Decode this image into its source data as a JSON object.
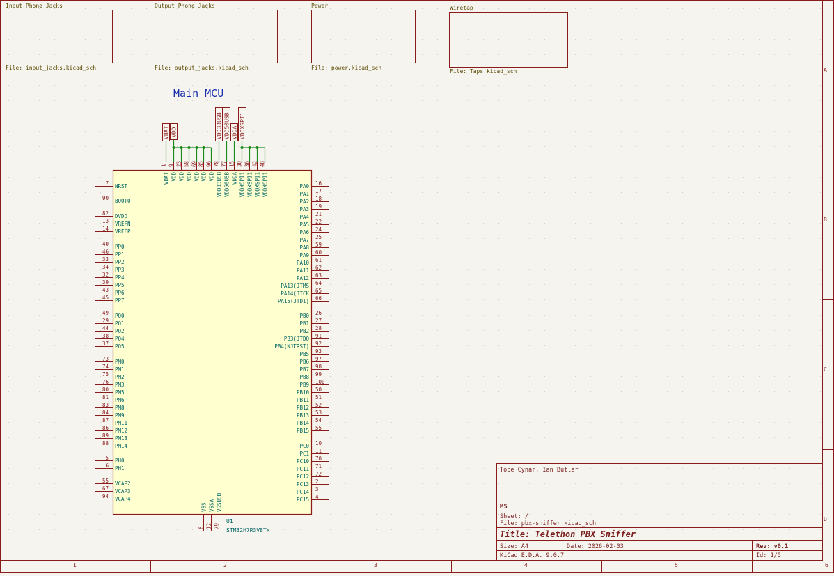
{
  "colors": {
    "background": "#f5f4ef",
    "border": "#8b1a1a",
    "wire": "#1a8a1a",
    "pin": "#8b1a1a",
    "pin_label": "#006464",
    "symbol_fill": "#ffffd0",
    "text_dark": "#7a1f1f",
    "note_blue": "#1a2fb0",
    "sheet_label": "#5a4a00"
  },
  "hier_sheets": [
    {
      "name": "Input Phone Jacks",
      "file": "File: input_jacks.kicad_sch"
    },
    {
      "name": "Output Phone Jacks",
      "file": "File: output_jacks.kicad_sch"
    },
    {
      "name": "Power",
      "file": "File: power.kicad_sch"
    },
    {
      "name": "Wiretap",
      "file": "File: Taps.kicad_sch"
    }
  ],
  "note": "Main MCU",
  "power_flags": [
    "VBAT",
    "VDD",
    "VDD33USB",
    "VDD50USB",
    "VDDA",
    "VDDXSPI1"
  ],
  "top_pins": [
    {
      "num": "1",
      "name": "VBAT"
    },
    {
      "num": "9",
      "name": "VDD"
    },
    {
      "num": "23",
      "name": "VDD"
    },
    {
      "num": "58",
      "name": "VDD"
    },
    {
      "num": "69",
      "name": "VDD"
    },
    {
      "num": "85",
      "name": "VDD"
    },
    {
      "num": "96",
      "name": "VDD"
    },
    {
      "num": "78",
      "name": "VDD33USB"
    },
    {
      "num": "77",
      "name": "VDD50USB"
    },
    {
      "num": "15",
      "name": "VDDA"
    },
    {
      "num": "30",
      "name": "VDDXSPI1"
    },
    {
      "num": "36",
      "name": "VDDXSPI1"
    },
    {
      "num": "42",
      "name": "VDDXSPI1"
    },
    {
      "num": "48",
      "name": "VDDXSPI1"
    }
  ],
  "left_pins": [
    {
      "num": "7",
      "name": "NRST"
    },
    {
      "num": "90",
      "name": "BOOT0"
    },
    {
      "num": "82",
      "name": "DVDD"
    },
    {
      "num": "13",
      "name": "VREFN"
    },
    {
      "num": "14",
      "name": "VREFP"
    },
    {
      "num": "40",
      "name": "PP0"
    },
    {
      "num": "46",
      "name": "PP1"
    },
    {
      "num": "33",
      "name": "PP2"
    },
    {
      "num": "34",
      "name": "PP3"
    },
    {
      "num": "32",
      "name": "PP4"
    },
    {
      "num": "39",
      "name": "PP5"
    },
    {
      "num": "43",
      "name": "PP6"
    },
    {
      "num": "45",
      "name": "PP7"
    },
    {
      "num": "49",
      "name": "PO0"
    },
    {
      "num": "29",
      "name": "PO1"
    },
    {
      "num": "44",
      "name": "PO2"
    },
    {
      "num": "38",
      "name": "PO4"
    },
    {
      "num": "37",
      "name": "PO5"
    },
    {
      "num": "73",
      "name": "PM0"
    },
    {
      "num": "74",
      "name": "PM1"
    },
    {
      "num": "75",
      "name": "PM2"
    },
    {
      "num": "76",
      "name": "PM3"
    },
    {
      "num": "80",
      "name": "PM5"
    },
    {
      "num": "81",
      "name": "PM6"
    },
    {
      "num": "83",
      "name": "PM8"
    },
    {
      "num": "84",
      "name": "PM9"
    },
    {
      "num": "87",
      "name": "PM11"
    },
    {
      "num": "86",
      "name": "PM12"
    },
    {
      "num": "89",
      "name": "PM13"
    },
    {
      "num": "88",
      "name": "PM14"
    },
    {
      "num": "5",
      "name": "PH0"
    },
    {
      "num": "6",
      "name": "PH1"
    },
    {
      "num": "55",
      "name": "VCAP2"
    },
    {
      "num": "67",
      "name": "VCAP3"
    },
    {
      "num": "94",
      "name": "VCAP4"
    }
  ],
  "right_pins": [
    {
      "num": "16",
      "name": "PA0"
    },
    {
      "num": "17",
      "name": "PA1"
    },
    {
      "num": "18",
      "name": "PA2"
    },
    {
      "num": "19",
      "name": "PA3"
    },
    {
      "num": "21",
      "name": "PA4"
    },
    {
      "num": "22",
      "name": "PA5"
    },
    {
      "num": "24",
      "name": "PA6"
    },
    {
      "num": "25",
      "name": "PA7"
    },
    {
      "num": "59",
      "name": "PA8"
    },
    {
      "num": "60",
      "name": "PA9"
    },
    {
      "num": "61",
      "name": "PA10"
    },
    {
      "num": "62",
      "name": "PA11"
    },
    {
      "num": "63",
      "name": "PA12"
    },
    {
      "num": "64",
      "name": "PA13(JTMS"
    },
    {
      "num": "65",
      "name": "PA14(JTCK"
    },
    {
      "num": "66",
      "name": "PA15(JTDI)"
    },
    {
      "num": "26",
      "name": "PB0"
    },
    {
      "num": "27",
      "name": "PB1"
    },
    {
      "num": "28",
      "name": "PB2"
    },
    {
      "num": "91",
      "name": "PB3(JTDO"
    },
    {
      "num": "92",
      "name": "PB4(NJTRST)"
    },
    {
      "num": "93",
      "name": "PB5"
    },
    {
      "num": "97",
      "name": "PB6"
    },
    {
      "num": "98",
      "name": "PB7"
    },
    {
      "num": "99",
      "name": "PB8"
    },
    {
      "num": "100",
      "name": "PB9"
    },
    {
      "num": "50",
      "name": "PB10"
    },
    {
      "num": "51",
      "name": "PB11"
    },
    {
      "num": "52",
      "name": "PB12"
    },
    {
      "num": "53",
      "name": "PB13"
    },
    {
      "num": "54",
      "name": "PB14"
    },
    {
      "num": "55",
      "name": "PB15"
    },
    {
      "num": "10",
      "name": "PC0"
    },
    {
      "num": "11",
      "name": "PC1"
    },
    {
      "num": "70",
      "name": "PC10"
    },
    {
      "num": "71",
      "name": "PC11"
    },
    {
      "num": "72",
      "name": "PC12"
    },
    {
      "num": "2",
      "name": "PC13"
    },
    {
      "num": "3",
      "name": "PC14"
    },
    {
      "num": "4",
      "name": "PC15"
    }
  ],
  "bottom_pins": [
    {
      "num": "8",
      "name": "VSS"
    },
    {
      "num": "12",
      "name": "VSSA"
    },
    {
      "num": "79",
      "name": "VSSUSB"
    }
  ],
  "reference": "U1",
  "part_value": "STM32H7R3V8Tx",
  "title_block": {
    "authors": "Tobe Cynar, Ian Butler",
    "company": "M5",
    "sheet": "Sheet: /",
    "file": "File: pbx-sniffer.kicad_sch",
    "title": "Title: Telethon PBX Sniffer",
    "size": "Size: A4",
    "date": "Date: 2026-02-03",
    "rev": "Rev: v0.1",
    "tool": "KiCad E.D.A. 9.0.7",
    "id": "Id: 1/5"
  },
  "border_columns": [
    "1",
    "2",
    "3",
    "4",
    "5",
    "6"
  ],
  "border_rows": [
    "A",
    "B",
    "C",
    "D"
  ]
}
